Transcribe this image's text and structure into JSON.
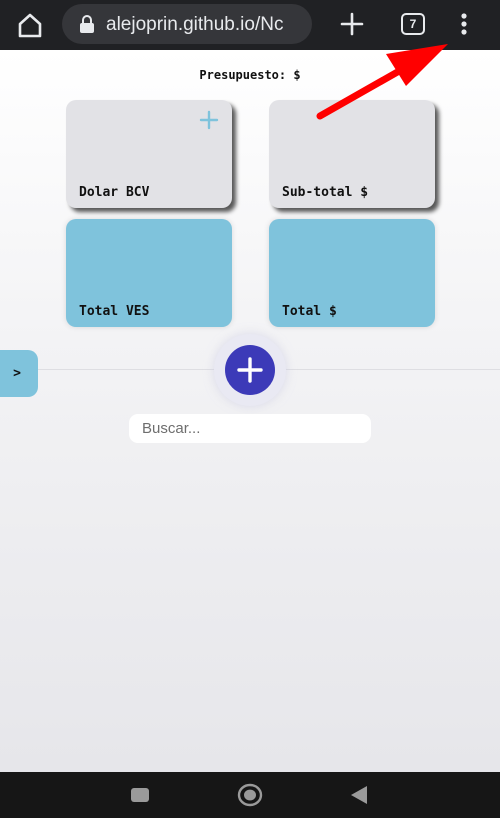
{
  "browser": {
    "url": "alejoprin.github.io/Nc",
    "tab_count": "7",
    "icons": {
      "home": "home-icon",
      "lock": "lock-icon",
      "new_tab": "plus-icon",
      "tabs": "tab-switcher-icon",
      "menu": "kebab-menu-icon"
    }
  },
  "page": {
    "budget_label": "Presupuesto: $",
    "cards": [
      {
        "label": "Dolar BCV",
        "style": "gray",
        "has_add": true
      },
      {
        "label": "Sub-total $",
        "style": "gray",
        "has_add": false
      },
      {
        "label": "Total VES",
        "style": "blue",
        "has_add": false
      },
      {
        "label": "Total $",
        "style": "blue",
        "has_add": false
      }
    ],
    "side_tab_label": ">",
    "search_placeholder": "Buscar...",
    "search_value": ""
  },
  "colors": {
    "accent_blue": "#7fc3dc",
    "fab": "#3c3ab8",
    "card_gray": "#e2e2e6",
    "annotation_arrow": "#ff0000",
    "chrome_bg": "#202124"
  },
  "android_nav": {
    "icons": [
      "recents-square-icon",
      "home-circle-icon",
      "back-triangle-icon"
    ]
  }
}
